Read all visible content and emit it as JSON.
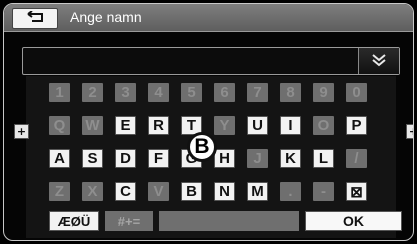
{
  "header": {
    "title": "Ange namn",
    "back_icon": "return-arrow-icon"
  },
  "input": {
    "collapse_icon": "double-chevron-down-icon"
  },
  "keyboard": {
    "rows": [
      {
        "keys": [
          {
            "label": "1",
            "enabled": false
          },
          {
            "label": "2",
            "enabled": false
          },
          {
            "label": "3",
            "enabled": false
          },
          {
            "label": "4",
            "enabled": false
          },
          {
            "label": "5",
            "enabled": false
          },
          {
            "label": "6",
            "enabled": false
          },
          {
            "label": "7",
            "enabled": false
          },
          {
            "label": "8",
            "enabled": false
          },
          {
            "label": "9",
            "enabled": false
          },
          {
            "label": "0",
            "enabled": false
          }
        ]
      },
      {
        "keys": [
          {
            "label": "Q",
            "enabled": false
          },
          {
            "label": "W",
            "enabled": false
          },
          {
            "label": "E",
            "enabled": true
          },
          {
            "label": "R",
            "enabled": true
          },
          {
            "label": "T",
            "enabled": true
          },
          {
            "label": "Y",
            "enabled": false
          },
          {
            "label": "U",
            "enabled": true
          },
          {
            "label": "I",
            "enabled": true
          },
          {
            "label": "O",
            "enabled": false
          },
          {
            "label": "P",
            "enabled": true
          }
        ]
      },
      {
        "keys": [
          {
            "label": "A",
            "enabled": true
          },
          {
            "label": "S",
            "enabled": true
          },
          {
            "label": "D",
            "enabled": true
          },
          {
            "label": "F",
            "enabled": true
          },
          {
            "label": "G",
            "enabled": true
          },
          {
            "label": "H",
            "enabled": true
          },
          {
            "label": "J",
            "enabled": false
          },
          {
            "label": "K",
            "enabled": true
          },
          {
            "label": "L",
            "enabled": true
          },
          {
            "label": "/",
            "enabled": false
          }
        ]
      },
      {
        "keys": [
          {
            "label": "Z",
            "enabled": false
          },
          {
            "label": "X",
            "enabled": false
          },
          {
            "label": "C",
            "enabled": true
          },
          {
            "label": "V",
            "enabled": false
          },
          {
            "label": "B",
            "enabled": true
          },
          {
            "label": "N",
            "enabled": true
          },
          {
            "label": "M",
            "enabled": true
          },
          {
            "label": ".",
            "enabled": false
          },
          {
            "label": "-",
            "enabled": false
          },
          {
            "label": "⊠",
            "enabled": true
          }
        ]
      }
    ],
    "side_plus_label": "+",
    "delete_icon": "backspace-icon"
  },
  "bottom": {
    "lang_label": "ÆØÜ",
    "symbols_label": "#+=",
    "ok_label": "OK"
  },
  "callout": {
    "label": "B"
  }
}
